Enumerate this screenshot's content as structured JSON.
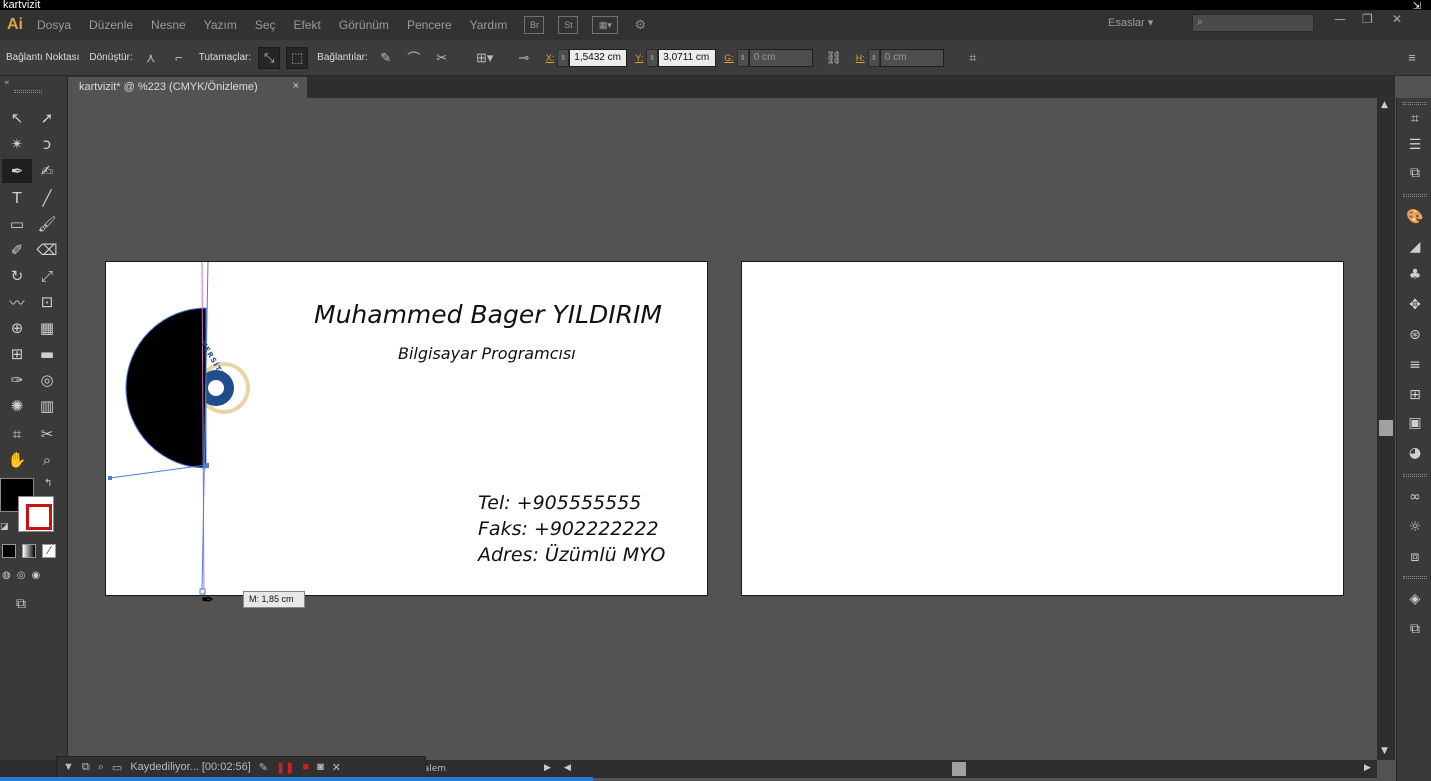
{
  "window": {
    "title": "kartvizit"
  },
  "app": {
    "logo": "Ai",
    "workspace": "Esaslar",
    "accent": "#2a7bd0"
  },
  "menu": {
    "items": [
      "Dosya",
      "Düzenle",
      "Nesne",
      "Yazım",
      "Seç",
      "Efekt",
      "Görünüm",
      "Pencere",
      "Yardım"
    ],
    "bridge": "Br",
    "stock": "St"
  },
  "control": {
    "anchor_label": "Bağlantı Noktası",
    "convert_label": "Dönüştür:",
    "handles_label": "Tutamaçlar:",
    "anchors_label": "Bağlantılar:",
    "x_label": "X:",
    "x_value": "1,5432 cm",
    "y_label": "Y:",
    "y_value": "3,0711 cm",
    "w_label": "G:",
    "w_value": "0 cm",
    "h_label": "H:",
    "h_value": "0 cm"
  },
  "document": {
    "tab_title": "kartvizit* @ %223 (CMYK/Önizleme)",
    "close": "×"
  },
  "card": {
    "name": "Muhammed Bager YILDIRIM",
    "job": "Bilgisayar Programcısı",
    "tel": "Tel: +905555555",
    "fax": "Faks: +902222222",
    "address": "Adres: Üzümlü MYO",
    "seal_text": "VERSİTESİ"
  },
  "tooltip": {
    "text": "M: 1,85 cm"
  },
  "status": {
    "recording": "Kaydediliyor... [00:02:56]",
    "tool": "Kalem"
  }
}
